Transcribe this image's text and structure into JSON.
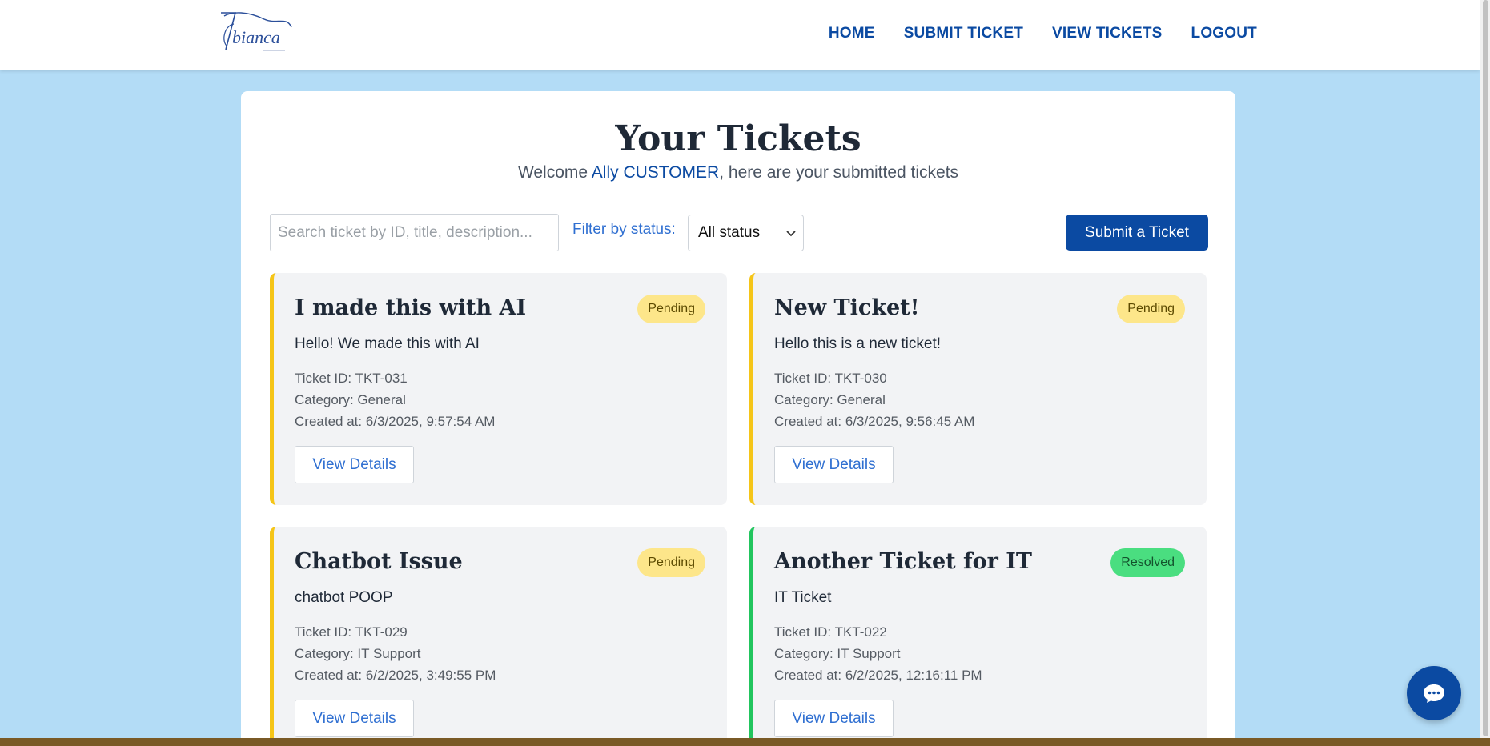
{
  "header": {
    "logo_text": "bianca",
    "nav": [
      "HOME",
      "SUBMIT TICKET",
      "VIEW TICKETS",
      "LOGOUT"
    ]
  },
  "page": {
    "title": "Your Tickets",
    "welcome_prefix": "Welcome ",
    "user_name": "Ally CUSTOMER",
    "welcome_suffix": ", here are your submitted tickets"
  },
  "toolbar": {
    "search_placeholder": "Search ticket by ID, title, description...",
    "filter_label": "Filter by status:",
    "status_selected": "All status",
    "submit_label": "Submit a Ticket"
  },
  "tickets": [
    {
      "title": "I made this with AI",
      "status": "Pending",
      "description": "Hello! We made this with AI",
      "ticket_id": "Ticket ID: TKT-031",
      "category": "Category: General",
      "created": "Created at: 6/3/2025, 9:57:54 AM",
      "action": "View Details"
    },
    {
      "title": "New Ticket!",
      "status": "Pending",
      "description": "Hello this is a new ticket!",
      "ticket_id": "Ticket ID: TKT-030",
      "category": "Category: General",
      "created": "Created at: 6/3/2025, 9:56:45 AM",
      "action": "View Details"
    },
    {
      "title": "Chatbot Issue",
      "status": "Pending",
      "description": "chatbot POOP",
      "ticket_id": "Ticket ID: TKT-029",
      "category": "Category: IT Support",
      "created": "Created at: 6/2/2025, 3:49:55 PM",
      "action": "View Details"
    },
    {
      "title": "Another Ticket for IT",
      "status": "Resolved",
      "description": "IT Ticket",
      "ticket_id": "Ticket ID: TKT-022",
      "category": "Category: IT Support",
      "created": "Created at: 6/2/2025, 12:16:11 PM",
      "action": "View Details"
    }
  ],
  "colors": {
    "brand": "#0b4aa2",
    "page_bg": "#b3dcf6",
    "pending_border": "#f5c518",
    "pending_badge": "#fde68a",
    "resolved_border": "#22c55e",
    "resolved_badge": "#4ade80"
  },
  "icons": {
    "chat_fab": "chat-bubble-icon",
    "select": "chevron-down-icon"
  }
}
